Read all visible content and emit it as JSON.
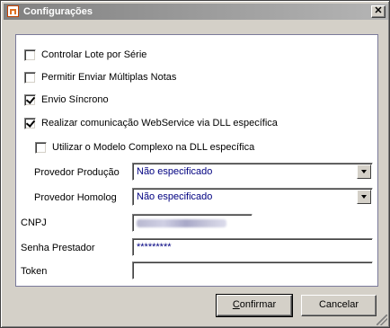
{
  "window": {
    "title": "Configurações",
    "close_glyph": "✕",
    "app_icon": "home-icon"
  },
  "options": [
    {
      "label": "Controlar Lote por Série",
      "checked": false
    },
    {
      "label": "Permitir Enviar Múltiplas Notas",
      "checked": false
    },
    {
      "label": "Envio Síncrono",
      "checked": true
    },
    {
      "label": "Realizar comunicação WebService via DLL específica",
      "checked": true
    },
    {
      "label": "Utilizar o Modelo Complexo na DLL específica",
      "checked": false
    }
  ],
  "fields": {
    "provedor_producao": {
      "label": "Provedor Produção",
      "value": "Não especificado"
    },
    "provedor_homolog": {
      "label": "Provedor Homolog",
      "value": "Não especificado"
    },
    "cnpj": {
      "label": "CNPJ",
      "value": ""
    },
    "senha": {
      "label": "Senha Prestador",
      "value": "*********"
    },
    "token": {
      "label": "Token",
      "value": ""
    }
  },
  "buttons": {
    "confirm_first": "C",
    "confirm_rest": "onfirmar",
    "cancel": "Cancelar"
  }
}
